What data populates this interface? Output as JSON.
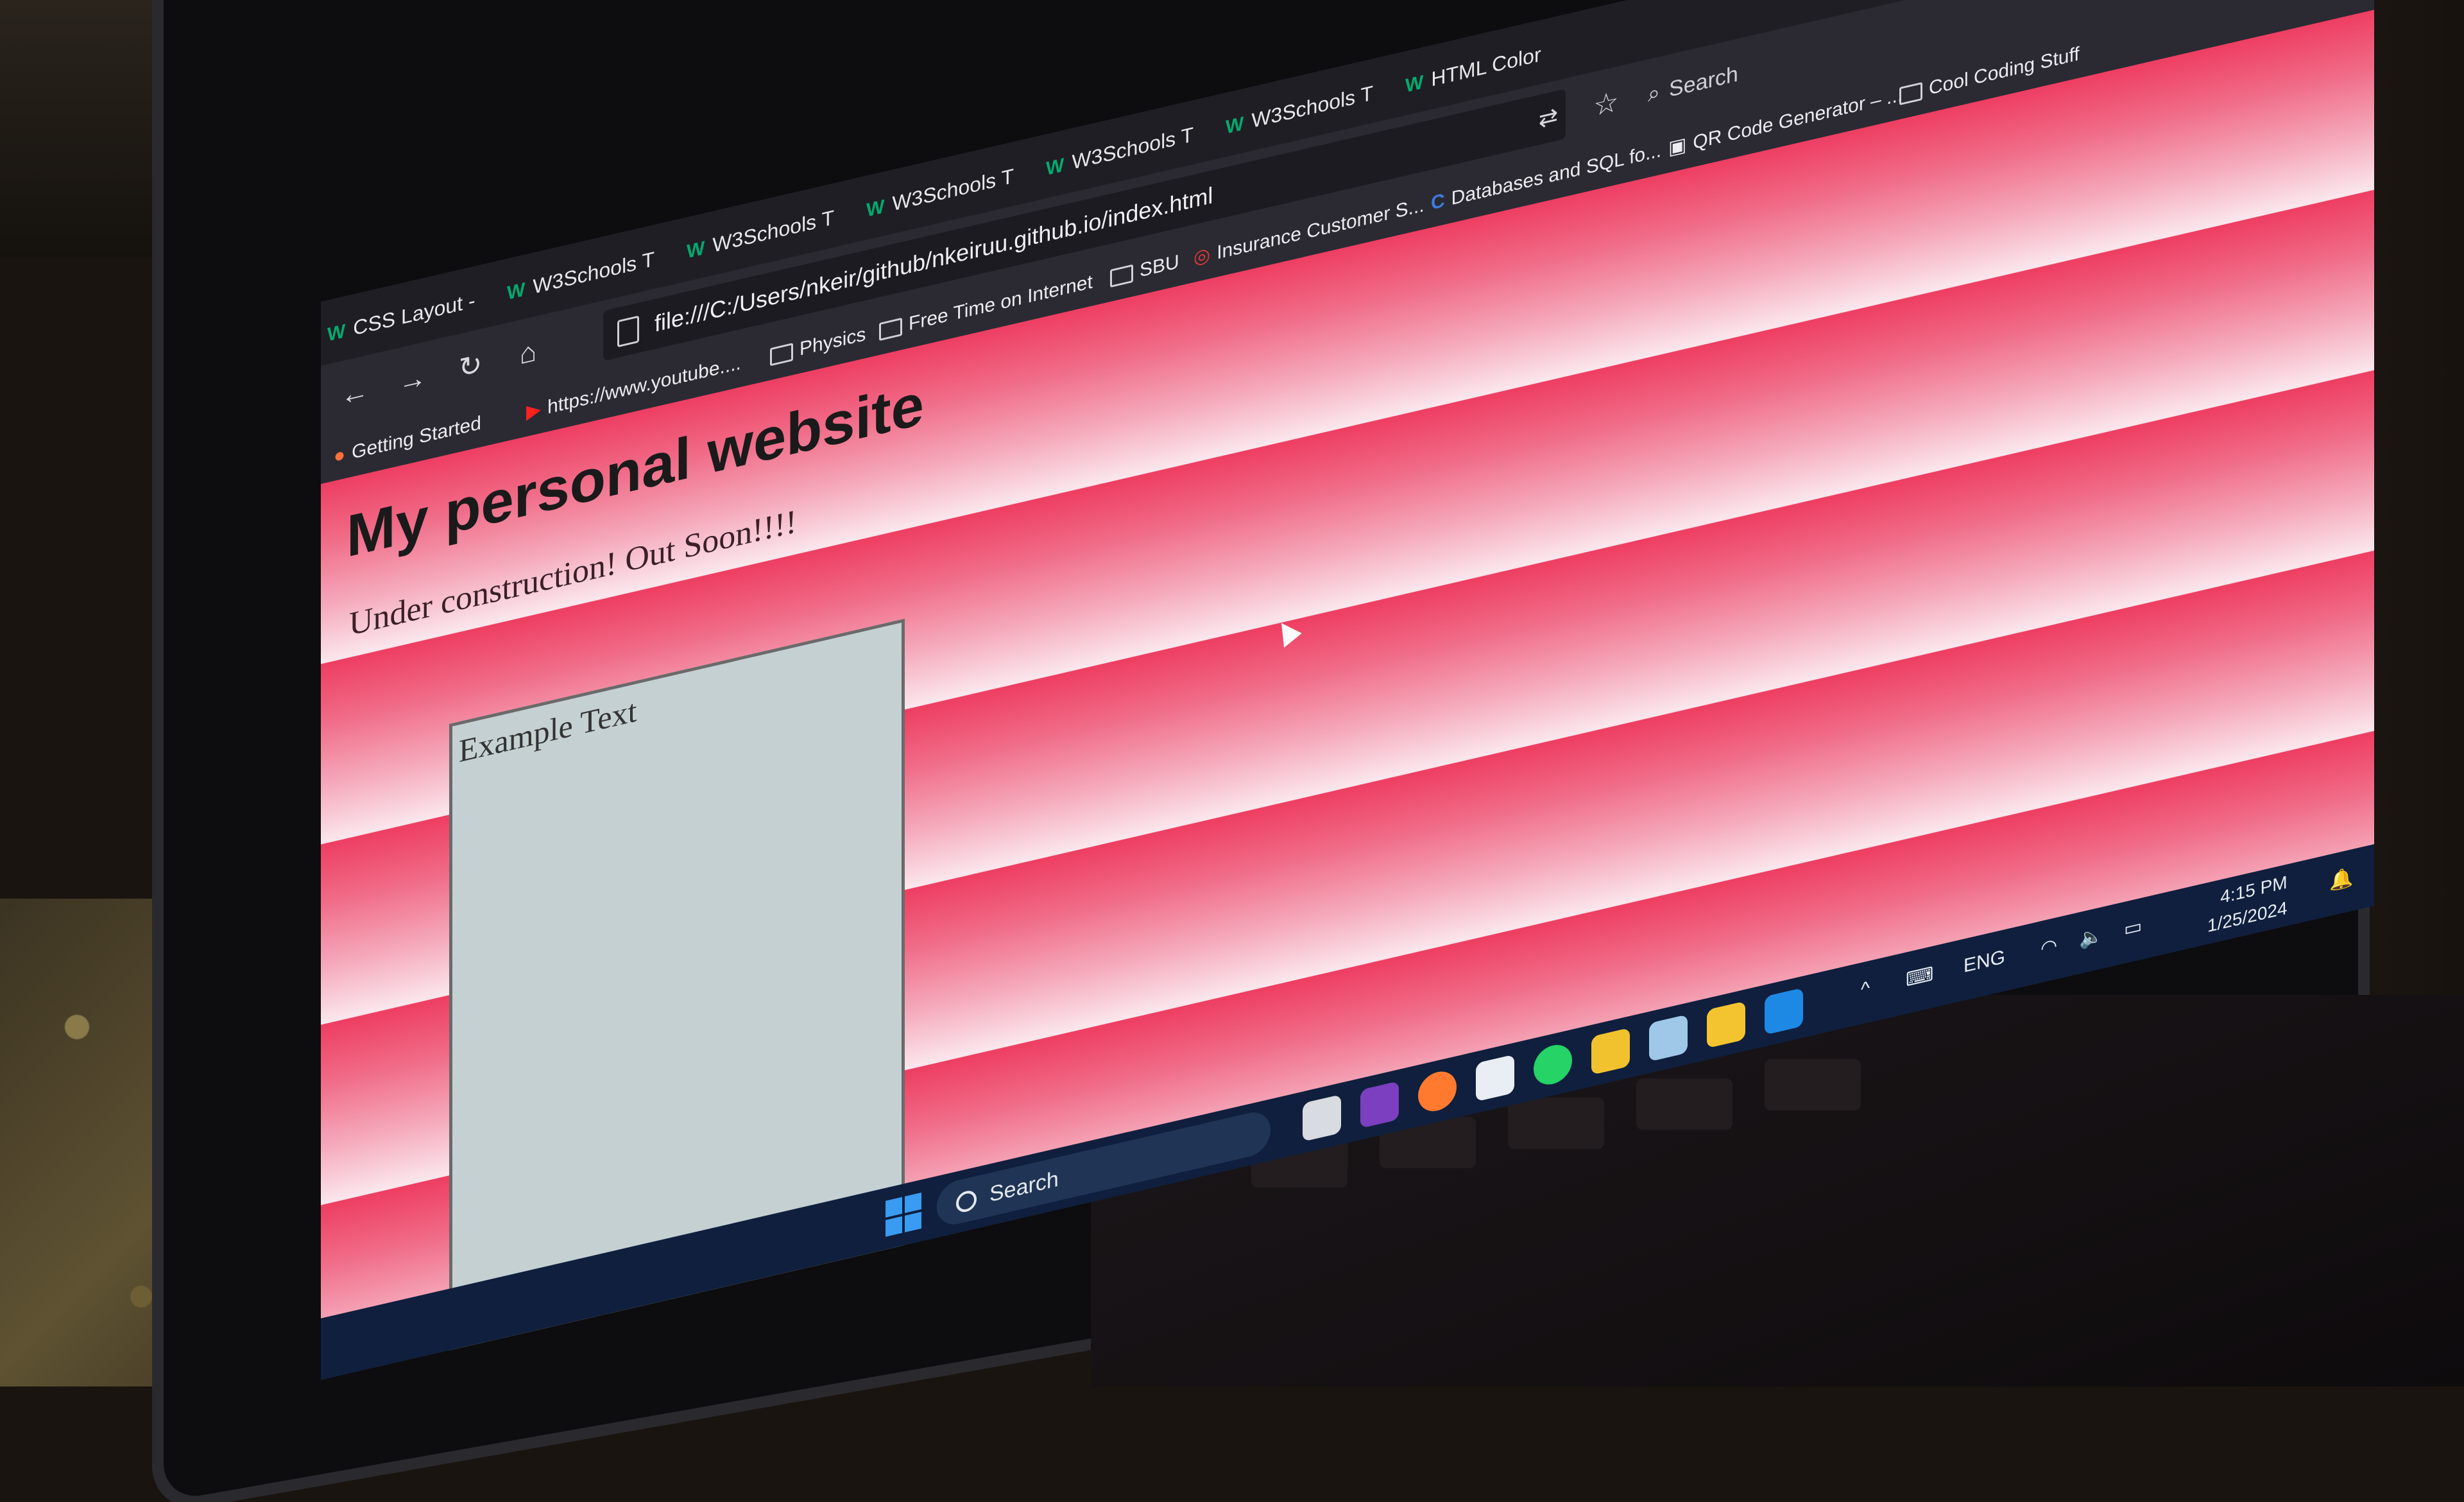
{
  "browser": {
    "tabs": [
      {
        "label": "CSS Layout -",
        "icon": "w3-icon"
      },
      {
        "label": "W3Schools T",
        "icon": "w3-icon"
      },
      {
        "label": "W3Schools T",
        "icon": "w3-icon"
      },
      {
        "label": "W3Schools T",
        "icon": "w3-icon"
      },
      {
        "label": "W3Schools T",
        "icon": "w3-icon"
      },
      {
        "label": "W3Schools T",
        "icon": "w3-icon"
      },
      {
        "label": "HTML Color",
        "icon": "w3-icon"
      }
    ],
    "url": "file:///C:/Users/nkeir/github/nkeiruu.github.io/index.html",
    "search_placeholder": "Search",
    "bookmarks": [
      {
        "label": "Getting Started",
        "icon": "firefox-icon"
      },
      {
        "label": "https://www.youtube....",
        "icon": "youtube-icon"
      },
      {
        "label": "Physics",
        "icon": "folder-icon"
      },
      {
        "label": "Free Time on Internet",
        "icon": "folder-icon"
      },
      {
        "label": "SBU",
        "icon": "folder-icon"
      },
      {
        "label": "Insurance Customer S...",
        "icon": "bookmark-icon"
      },
      {
        "label": "Databases and SQL fo...",
        "icon": "bookmark-icon"
      },
      {
        "label": "QR Code Generator – ...",
        "icon": "bookmark-icon"
      },
      {
        "label": "Cool Coding Stuff",
        "icon": "folder-icon"
      }
    ]
  },
  "page": {
    "title": "My personal website",
    "subtitle": "Under construction! Out Soon!!!!",
    "box_text": "Example Text"
  },
  "taskbar": {
    "search_label": "Search",
    "language": "ENG",
    "time": "4:15 PM",
    "date": "1/25/2024"
  },
  "colors": {
    "page_stripe_dark": "#ee3e62",
    "page_stripe_light": "#fbe7ed",
    "box_fill": "#c5d0d3",
    "taskbar": "#0f1f3d",
    "w3_green": "#04aa6d"
  }
}
